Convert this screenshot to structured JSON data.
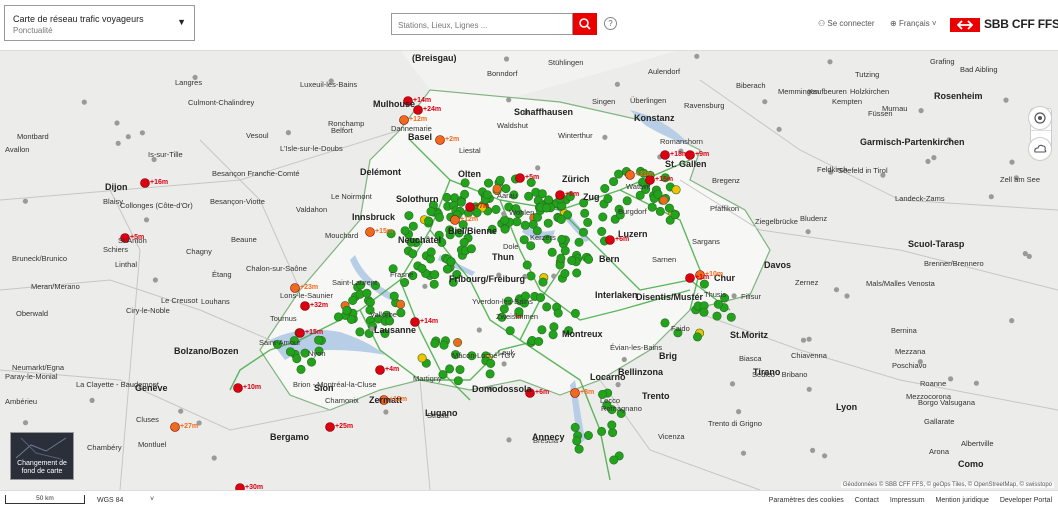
{
  "header": {
    "selector_title": "Carte de réseau trafic voyageurs",
    "selector_subtitle": "Ponctualité",
    "search_placeholder": "Stations, Lieux, Lignes ...",
    "help": "?",
    "login": "Se connecter",
    "language": "Français",
    "logo_text": "SBB CFF FFS",
    "brand_color": "#eb0000"
  },
  "colors": {
    "on_time": "#22a31c",
    "slight_delay": "#f2c200",
    "delay": "#f06a1e",
    "heavy_delay": "#d90012",
    "rail": "#3aa53a",
    "lake": "#b8cde6",
    "border": "#7fb37f"
  },
  "map": {
    "labels": [
      {
        "t": "(Breisgau)",
        "c": 1
      },
      {
        "t": "Bonndorf"
      },
      {
        "t": "Stühlingen"
      },
      {
        "t": "Aulendorf"
      },
      {
        "t": "Singen"
      },
      {
        "t": "Überlingen"
      },
      {
        "t": "Ravensburg"
      },
      {
        "t": "Biberach"
      },
      {
        "t": "Memmingen"
      },
      {
        "t": "Kaufbeuren"
      },
      {
        "t": "Tutzing"
      },
      {
        "t": "Holzkirchen"
      },
      {
        "t": "Grafing"
      },
      {
        "t": "Bad Aibling"
      },
      {
        "t": "Rosenheim",
        "c": 1
      },
      {
        "t": "Langres"
      },
      {
        "t": "Culmont-Chalindrey"
      },
      {
        "t": "Luxeuil-les-Bains"
      },
      {
        "t": "Mulhouse",
        "c": 1
      },
      {
        "t": "Schaffhausen",
        "c": 1
      },
      {
        "t": "Konstanz",
        "c": 1
      },
      {
        "t": "Kempten"
      },
      {
        "t": "Füssen"
      },
      {
        "t": "Murnau"
      },
      {
        "t": "Basel",
        "c": 1
      },
      {
        "t": "Dannemarie"
      },
      {
        "t": "Waldshut"
      },
      {
        "t": "Ronchamp"
      },
      {
        "t": "Belfort"
      },
      {
        "t": "Romanshorn"
      },
      {
        "t": "Garmisch-Partenkirchen",
        "c": 1
      },
      {
        "t": "Montbard"
      },
      {
        "t": "Vesoul"
      },
      {
        "t": "Liestal"
      },
      {
        "t": "Winterthur"
      },
      {
        "t": "St. Gallen",
        "c": 1
      },
      {
        "t": "Bregenz"
      },
      {
        "t": "Avallon"
      },
      {
        "t": "Is-sur-Tille"
      },
      {
        "t": "L'Isle-sur-le-Doubs"
      },
      {
        "t": "Delémont",
        "c": 1
      },
      {
        "t": "Olten",
        "c": 1
      },
      {
        "t": "Zürich",
        "c": 1
      },
      {
        "t": "Feldkirch"
      },
      {
        "t": "Seefeld in Tirol"
      },
      {
        "t": "Dijon",
        "c": 1
      },
      {
        "t": "Besançon Franche-Comté"
      },
      {
        "t": "Le Noirmont"
      },
      {
        "t": "Aarau"
      },
      {
        "t": "Wattwil"
      },
      {
        "t": "Zell am See"
      },
      {
        "t": "Blaisy"
      },
      {
        "t": "Collonges (Côte-d'Or)"
      },
      {
        "t": "Besançon-Viotte"
      },
      {
        "t": "Valdahon"
      },
      {
        "t": "Solothurn",
        "c": 1
      },
      {
        "t": "Wohlen"
      },
      {
        "t": "Zug",
        "c": 1
      },
      {
        "t": "Pfäffikon"
      },
      {
        "t": "Bludenz"
      },
      {
        "t": "Landeck-Zams"
      },
      {
        "t": "Innsbruck",
        "c": 1
      },
      {
        "t": "Biel/Bienne",
        "c": 1
      },
      {
        "t": "Burgdorf"
      },
      {
        "t": "Ziegelbrücke"
      },
      {
        "t": "St.Anton"
      },
      {
        "t": "Beaune"
      },
      {
        "t": "Mouchard"
      },
      {
        "t": "Neuchâtel",
        "c": 1
      },
      {
        "t": "Kerzers"
      },
      {
        "t": "Luzern",
        "c": 1
      },
      {
        "t": "Sargans"
      },
      {
        "t": "Schiers"
      },
      {
        "t": "Chagny"
      },
      {
        "t": "Dole"
      },
      {
        "t": "Bern",
        "c": 1
      },
      {
        "t": "Linthal"
      },
      {
        "t": "Chalon-sur-Saône"
      },
      {
        "t": "Frasne"
      },
      {
        "t": "Fribourg/Freiburg",
        "c": 1
      },
      {
        "t": "Thun",
        "c": 1
      },
      {
        "t": "Sarnen"
      },
      {
        "t": "Chur",
        "c": 1
      },
      {
        "t": "Davos",
        "c": 1
      },
      {
        "t": "Scuol-Tarasp",
        "c": 1
      },
      {
        "t": "Brenner/Brennero"
      },
      {
        "t": "Bruneck/Brunico"
      },
      {
        "t": "Étang"
      },
      {
        "t": "Saint-Laurent"
      },
      {
        "t": "Yverdon-les-Bains"
      },
      {
        "t": "Interlaken",
        "c": 1
      },
      {
        "t": "Disentis/Mustér",
        "c": 1
      },
      {
        "t": "Thusis"
      },
      {
        "t": "Filisur"
      },
      {
        "t": "Zernez"
      },
      {
        "t": "Mals/Malles Venosta"
      },
      {
        "t": "Meran/Merano"
      },
      {
        "t": "Le Creusot"
      },
      {
        "t": "Louhans"
      },
      {
        "t": "Lons-le-Saunier"
      },
      {
        "t": "Vallorbe"
      },
      {
        "t": "Zweisimmen"
      },
      {
        "t": "Oberwald"
      },
      {
        "t": "Ciry-le-Noble"
      },
      {
        "t": "Tournus"
      },
      {
        "t": "Lausanne",
        "c": 1
      },
      {
        "t": "Montreux",
        "c": 1
      },
      {
        "t": "Faido"
      },
      {
        "t": "St.Moritz",
        "c": 1
      },
      {
        "t": "Bernina"
      },
      {
        "t": "Bolzano/Bozen",
        "c": 1
      },
      {
        "t": "Saint-Amour"
      },
      {
        "t": "Nyon"
      },
      {
        "t": "Évian-les-Bains"
      },
      {
        "t": "Biasca"
      },
      {
        "t": "Poschiavo"
      },
      {
        "t": "Neumarkt/Egna"
      },
      {
        "t": "Paray-le-Monial"
      },
      {
        "t": "La Clayette - Baudemont"
      },
      {
        "t": "Mâcon-Loché-TGV"
      },
      {
        "t": "Leuk"
      },
      {
        "t": "Brig",
        "c": 1
      },
      {
        "t": "Chiavenna"
      },
      {
        "t": "Mezzana"
      },
      {
        "t": "Genève",
        "c": 1
      },
      {
        "t": "Sion",
        "c": 1
      },
      {
        "t": "Domodossola",
        "c": 1
      },
      {
        "t": "Bellinzona",
        "c": 1
      },
      {
        "t": "Tirano",
        "c": 1
      },
      {
        "t": "Mezzocorona"
      },
      {
        "t": "Brion - Montréal-la-Cluse"
      },
      {
        "t": "Martigny"
      },
      {
        "t": "Locarno",
        "c": 1
      },
      {
        "t": "Sedico - Bribano"
      },
      {
        "t": "Roanne"
      },
      {
        "t": "Ambérieu"
      },
      {
        "t": "Cluses"
      },
      {
        "t": "Chamonix"
      },
      {
        "t": "Zermatt",
        "c": 1
      },
      {
        "t": "Lugano",
        "c": 1
      },
      {
        "t": "Romagnano"
      },
      {
        "t": "Trento",
        "c": 1
      },
      {
        "t": "Borgo Valsugana"
      },
      {
        "t": "Feltre"
      },
      {
        "t": "Montluel"
      },
      {
        "t": "Annecy",
        "c": 1
      },
      {
        "t": "Stresa"
      },
      {
        "t": "Lecco"
      },
      {
        "t": "Trento di Grigno"
      },
      {
        "t": "Lyon",
        "c": 1
      },
      {
        "t": "Albertville"
      },
      {
        "t": "Arona"
      },
      {
        "t": "Como",
        "c": 1
      },
      {
        "t": "Bergamo",
        "c": 1
      },
      {
        "t": "Brescia"
      },
      {
        "t": "Vicenza"
      },
      {
        "t": "Gallarate"
      },
      {
        "t": "Chambéry"
      }
    ],
    "delays": [
      "+14m",
      "+12m",
      "+16m",
      "+5m",
      "+23m",
      "+15m",
      "+32m",
      "+15m",
      "+14m",
      "+10m",
      "+27m",
      "+25m",
      "+4m",
      "+12m",
      "+7m",
      "+8m",
      "+31m",
      "+18m",
      "+9m",
      "+10m",
      "+1m",
      "+6m",
      "+8m",
      "+30m",
      "+24m",
      "+2m",
      "+5m",
      "+15m",
      "+12m",
      "+6m"
    ]
  },
  "controls": {
    "zoom_in": "+",
    "zoom_out": "−"
  },
  "bg_switch_label": "Changement de fond de carte",
  "attribution": "Géodonnées © SBB CFF FFS, © geOps Tiles, © OpenStreetMap, © swisstopo",
  "footer": {
    "scale": "50 km",
    "projection": "WGS 84",
    "links": [
      "Paramètres des cookies",
      "Contact",
      "Impressum",
      "Mention juridique",
      "Developer Portal"
    ]
  }
}
